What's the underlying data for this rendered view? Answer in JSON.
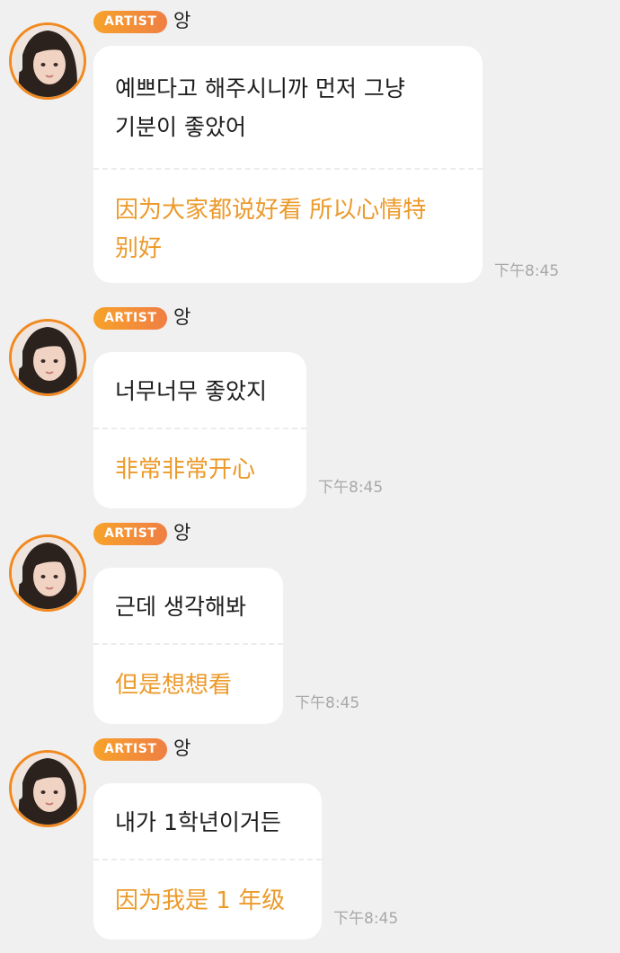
{
  "messages": [
    {
      "badge": "ARTIST",
      "name": "앙",
      "korean": "예쁘다고 해주시니까 먼저 그냥\n기분이 좋았어",
      "chinese": "因为大家都说好看 所以心情特\n别好",
      "time": "下午8:45"
    },
    {
      "badge": "ARTIST",
      "name": "앙",
      "korean": "너무너무 좋았지",
      "chinese": "非常非常开心",
      "time": "下午8:45"
    },
    {
      "badge": "ARTIST",
      "name": "앙",
      "korean": "근데 생각해봐",
      "chinese": "但是想想看",
      "time": "下午8:45"
    },
    {
      "badge": "ARTIST",
      "name": "앙",
      "korean": "내가 1학년이거든",
      "chinese": "因为我是 1 年级",
      "time": "下午8:45"
    }
  ],
  "colors": {
    "background": "#f0f0f1",
    "bubble": "#ffffff",
    "translation_text": "#ec9a2b",
    "badge_gradient_start": "#f7a22b",
    "badge_gradient_end": "#ef7f43",
    "avatar_ring": "#f0891f",
    "timestamp": "#a8a8a8"
  }
}
